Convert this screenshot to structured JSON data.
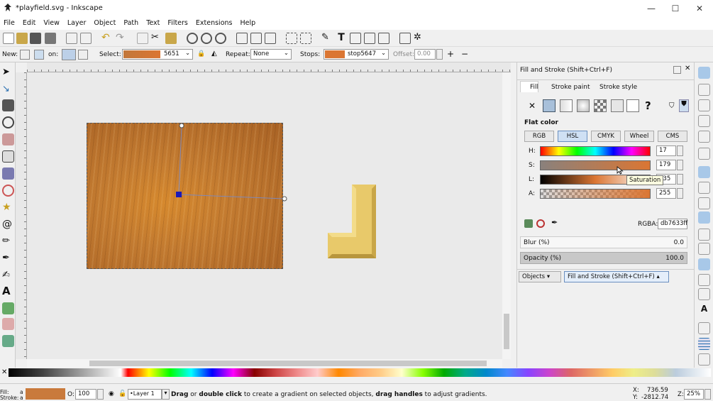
{
  "window": {
    "title": "*playfield.svg - Inkscape",
    "min": "—",
    "max": "☐",
    "close": "✕"
  },
  "menu": [
    "File",
    "Edit",
    "View",
    "Layer",
    "Object",
    "Path",
    "Text",
    "Filters",
    "Extensions",
    "Help"
  ],
  "controls": {
    "new_label": "New:",
    "on_label": "on:",
    "select_label": "Select:",
    "select_value": "5651",
    "repeat_label": "Repeat:",
    "repeat_value": "None",
    "stops_label": "Stops:",
    "stop_value": "stop5647",
    "offset_label": "Offset:",
    "offset_value": "0.00"
  },
  "panel": {
    "title": "Fill and Stroke (Shift+Ctrl+F)",
    "tabs": {
      "fill": "Fill",
      "stroke_paint": "Stroke paint",
      "stroke_style": "Stroke style"
    },
    "no_paint": "✕",
    "unknown": "?",
    "flat_color": "Flat color",
    "modes": [
      "RGB",
      "HSL",
      "CMYK",
      "Wheel",
      "CMS"
    ],
    "h_label": "H:",
    "s_label": "S:",
    "l_label": "L:",
    "a_label": "A:",
    "h_value": "17",
    "s_value": "179",
    "l_value": "135",
    "a_value": "255",
    "tooltip": "Saturation",
    "rgba_label": "RGBA:",
    "rgba_value": "db7633ff",
    "blur_label": "Blur (%)",
    "blur_value": "0.0",
    "opacity_label": "Opacity (%)",
    "opacity_value": "100.0",
    "docks": {
      "objects": "Objects",
      "fill_stroke": "Fill and Stroke (Shift+Ctrl+F)"
    }
  },
  "status": {
    "fill_label": "Fill:",
    "fill_swatch": "a",
    "stroke_label": "Stroke:",
    "stroke_swatch": "a",
    "opacity_label": "O:",
    "opacity_value": "100",
    "layer": "•Layer 1",
    "msg_bold1": "Drag",
    "msg_or": " or ",
    "msg_bold2": "double click",
    "msg_mid": " to create a gradient on selected objects, ",
    "msg_bold3": "drag handles",
    "msg_end": " to adjust gradients.",
    "x_label": "X:",
    "x_value": "736.59",
    "y_label": "Y:",
    "y_value": "-2812.74",
    "z_label": "Z:",
    "zoom": "25%"
  },
  "colors": {
    "accent": "#db7633",
    "wood": "#c27a30",
    "lshape": "#e8c96a"
  }
}
